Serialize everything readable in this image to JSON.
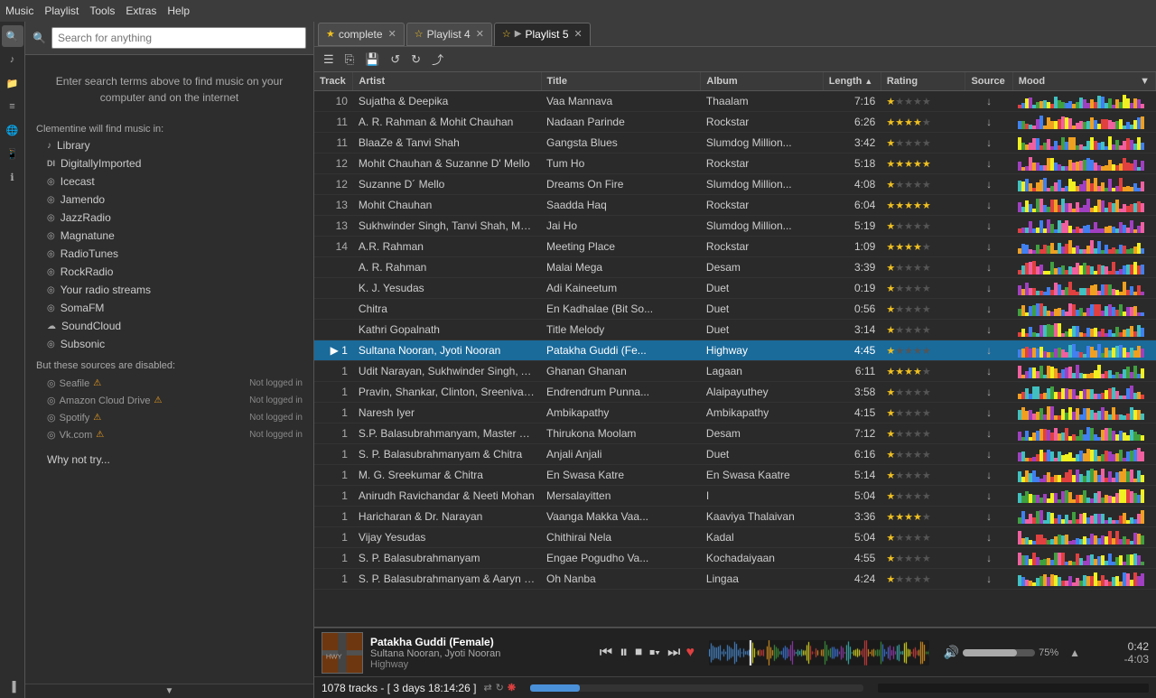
{
  "menubar": {
    "items": [
      "Music",
      "Playlist",
      "Tools",
      "Extras",
      "Help"
    ]
  },
  "sidebar": {
    "search_placeholder": "Search for anything",
    "search_hint": "Enter search terms above to find music on your computer and on the internet",
    "clementine_label": "Clementine will find music in:",
    "sources": [
      {
        "icon": "♪",
        "label": "Library"
      },
      {
        "icon": "DI",
        "label": "DigitallyImported"
      },
      {
        "icon": "◎",
        "label": "Icecast"
      },
      {
        "icon": "◎",
        "label": "Jamendo"
      },
      {
        "icon": "◎",
        "label": "JazzRadio"
      },
      {
        "icon": "◎",
        "label": "Magnatune"
      },
      {
        "icon": "◎",
        "label": "RadioTunes"
      },
      {
        "icon": "◎",
        "label": "RockRadio"
      },
      {
        "icon": "◎",
        "label": "Your radio streams"
      },
      {
        "icon": "◎",
        "label": "SomaFM"
      },
      {
        "icon": "☁",
        "label": "SoundCloud"
      },
      {
        "icon": "◎",
        "label": "Subsonic"
      }
    ],
    "disabled_label": "But these sources are disabled:",
    "disabled_sources": [
      {
        "label": "Seafile",
        "status": "Not logged in"
      },
      {
        "label": "Amazon Cloud Drive",
        "status": "Not logged in"
      },
      {
        "label": "Spotify",
        "status": "Not logged in"
      },
      {
        "label": "Vk.com",
        "status": "Not logged in"
      }
    ],
    "why_not": "Why not try..."
  },
  "tabs": [
    {
      "id": "complete",
      "label": "complete",
      "starred": true,
      "active": false,
      "has_play": false
    },
    {
      "id": "playlist4",
      "label": "Playlist 4",
      "starred": true,
      "active": false,
      "has_play": false
    },
    {
      "id": "playlist5",
      "label": "Playlist 5",
      "starred": true,
      "active": true,
      "has_play": true
    }
  ],
  "table": {
    "columns": [
      "Track",
      "Artist",
      "Title",
      "Album",
      "Length",
      "Rating",
      "Source",
      "Mood"
    ],
    "rows": [
      {
        "track": "10",
        "artist": "Sujatha & Deepika",
        "title": "Vaa Mannava",
        "album": "Thaalam",
        "length": "7:16",
        "rating": 1,
        "playing": false
      },
      {
        "track": "11",
        "artist": "A. R. Rahman & Mohit Chauhan",
        "title": "Nadaan Parinde",
        "album": "Rockstar",
        "length": "6:26",
        "rating": 4,
        "playing": false
      },
      {
        "track": "11",
        "artist": "BlaaZe & Tanvi Shah",
        "title": "Gangsta Blues",
        "album": "Slumdog Million...",
        "length": "3:42",
        "rating": 1,
        "playing": false
      },
      {
        "track": "12",
        "artist": "Mohit Chauhan & Suzanne D' Mello",
        "title": "Tum Ho",
        "album": "Rockstar",
        "length": "5:18",
        "rating": 5,
        "playing": false
      },
      {
        "track": "12",
        "artist": "Suzanne D´ Mello",
        "title": "Dreams On Fire",
        "album": "Slumdog Million...",
        "length": "4:08",
        "rating": 1,
        "playing": false
      },
      {
        "track": "13",
        "artist": "Mohit Chauhan",
        "title": "Saadda Haq",
        "album": "Rockstar",
        "length": "6:04",
        "rating": 5,
        "playing": false
      },
      {
        "track": "13",
        "artist": "Sukhwinder Singh, Tanvi Shah, Mah...",
        "title": "Jai Ho",
        "album": "Slumdog Million...",
        "length": "5:19",
        "rating": 1,
        "playing": false
      },
      {
        "track": "14",
        "artist": "A.R. Rahman",
        "title": "Meeting Place",
        "album": "Rockstar",
        "length": "1:09",
        "rating": 4,
        "playing": false
      },
      {
        "track": "",
        "artist": "A. R. Rahman",
        "title": "Malai Mega",
        "album": "Desam",
        "length": "3:39",
        "rating": 1,
        "playing": false
      },
      {
        "track": "",
        "artist": "K. J. Yesudas",
        "title": "Adi Kaineetum",
        "album": "Duet",
        "length": "0:19",
        "rating": 1,
        "playing": false
      },
      {
        "track": "",
        "artist": "Chitra",
        "title": "En Kadhalae (Bit So...",
        "album": "Duet",
        "length": "0:56",
        "rating": 1,
        "playing": false
      },
      {
        "track": "",
        "artist": "Kathri Gopalnath",
        "title": "Title Melody",
        "album": "Duet",
        "length": "3:14",
        "rating": 1,
        "playing": false
      },
      {
        "track": "▶ 1",
        "artist": "Sultana Nooran, Jyoti Nooran",
        "title": "Patakha Guddi (Fe...",
        "album": "Highway",
        "length": "4:45",
        "rating": 1,
        "playing": true
      },
      {
        "track": "1",
        "artist": "Udit Narayan, Sukhwinder Singh, Al...",
        "title": "Ghanan Ghanan",
        "album": "Lagaan",
        "length": "6:11",
        "rating": 4,
        "playing": false
      },
      {
        "track": "1",
        "artist": "Pravin, Shankar, Clinton, Sreenivas ...",
        "title": "Endrendrum Punna...",
        "album": "Alaipayuthey",
        "length": "3:58",
        "rating": 1,
        "playing": false
      },
      {
        "track": "1",
        "artist": "Naresh Iyer",
        "title": "Ambikapathy",
        "album": "Ambikapathy",
        "length": "4:15",
        "rating": 1,
        "playing": false
      },
      {
        "track": "1",
        "artist": "S.P. Balasubrahmanyam, Master Vig...",
        "title": "Thirukona Moolam",
        "album": "Desam",
        "length": "7:12",
        "rating": 1,
        "playing": false
      },
      {
        "track": "1",
        "artist": "S. P. Balasubrahmanyam & Chitra",
        "title": "Anjali Anjali",
        "album": "Duet",
        "length": "6:16",
        "rating": 1,
        "playing": false
      },
      {
        "track": "1",
        "artist": "M. G. Sreekumar & Chitra",
        "title": "En Swasa Katre",
        "album": "En Swasa Kaatre",
        "length": "5:14",
        "rating": 1,
        "playing": false
      },
      {
        "track": "1",
        "artist": "Anirudh Ravichandar & Neeti Mohan",
        "title": "Mersalayitten",
        "album": "I",
        "length": "5:04",
        "rating": 1,
        "playing": false
      },
      {
        "track": "1",
        "artist": "Haricharan & Dr. Narayan",
        "title": "Vaanga Makka Vaa...",
        "album": "Kaaviya Thalaivan",
        "length": "3:36",
        "rating": 4,
        "playing": false
      },
      {
        "track": "1",
        "artist": "Vijay Yesudas",
        "title": "Chithirai Nela",
        "album": "Kadal",
        "length": "5:04",
        "rating": 1,
        "playing": false
      },
      {
        "track": "1",
        "artist": "S. P. Balasubrahmanyam",
        "title": "Engae Pogudho Va...",
        "album": "Kochadaiyaan",
        "length": "4:55",
        "rating": 1,
        "playing": false
      },
      {
        "track": "1",
        "artist": "S. P. Balasubrahmanyam & Aaryn D...",
        "title": "Oh Nanba",
        "album": "Lingaa",
        "length": "4:24",
        "rating": 1,
        "playing": false
      }
    ]
  },
  "player": {
    "now_playing_title": "Patakha Guddi (Female)",
    "now_playing_artist": "Sultana Nooran, Jyoti Nooran",
    "now_playing_album": "Highway",
    "time_elapsed": "0:42",
    "time_remaining": "-4:03",
    "volume": "75%",
    "status_bar": "1078 tracks - [ 3 days 18:14:26 ]"
  },
  "side_icons": [
    {
      "name": "search",
      "glyph": "🔍"
    },
    {
      "name": "library",
      "glyph": "♪"
    },
    {
      "name": "files",
      "glyph": "📁"
    },
    {
      "name": "playlists",
      "glyph": "≡"
    },
    {
      "name": "internet",
      "glyph": "🌐"
    },
    {
      "name": "devices",
      "glyph": "📱"
    },
    {
      "name": "song-info",
      "glyph": "ℹ"
    },
    {
      "name": "equalizer",
      "glyph": "▐"
    }
  ]
}
